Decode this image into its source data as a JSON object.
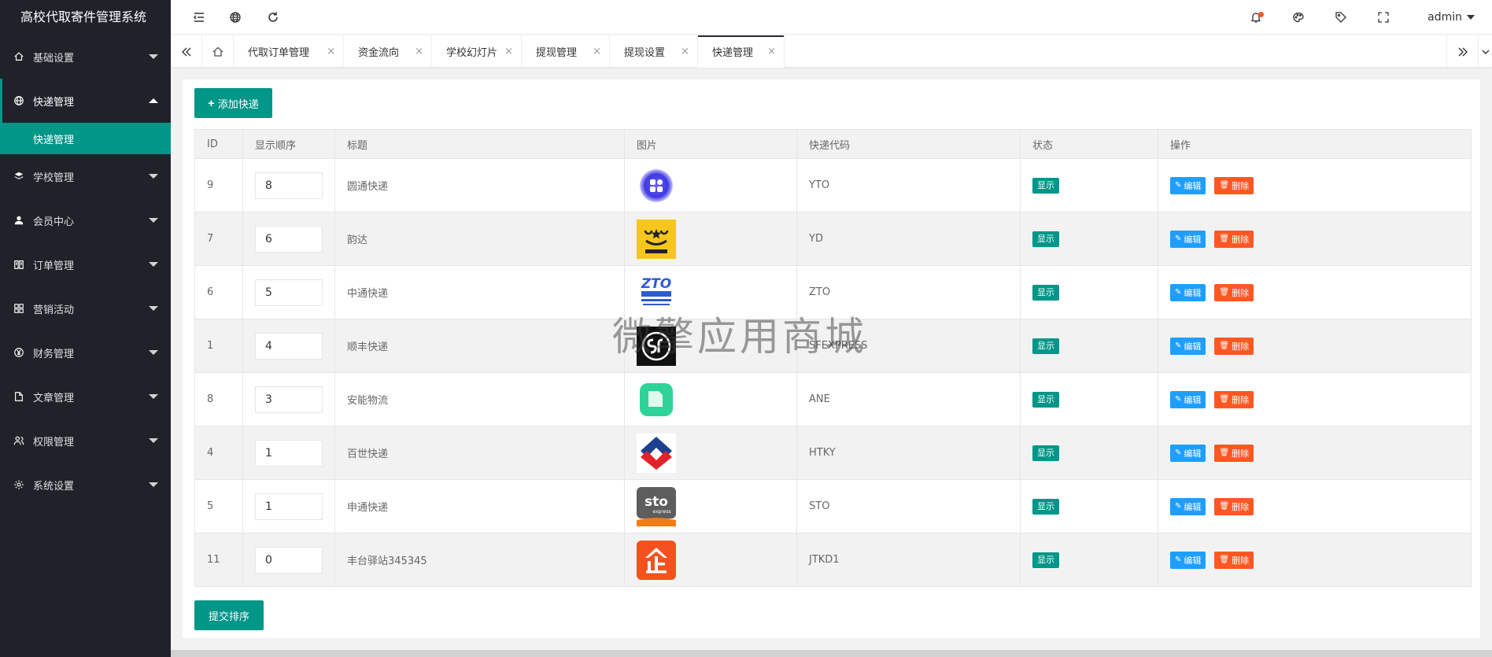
{
  "app": {
    "title": "高校代取寄件管理系统"
  },
  "sidebar": {
    "items": [
      {
        "label": "基础设置",
        "icon": "home-icon",
        "open": false
      },
      {
        "label": "快递管理",
        "icon": "globe-icon",
        "open": true,
        "sub": [
          {
            "label": "快递管理"
          }
        ]
      },
      {
        "label": "学校管理",
        "icon": "layers-icon",
        "open": false
      },
      {
        "label": "会员中心",
        "icon": "user-icon",
        "open": false
      },
      {
        "label": "订单管理",
        "icon": "book-icon",
        "open": false
      },
      {
        "label": "营销活动",
        "icon": "apps-icon",
        "open": false
      },
      {
        "label": "财务管理",
        "icon": "yen-icon",
        "open": false
      },
      {
        "label": "文章管理",
        "icon": "file-icon",
        "open": false
      },
      {
        "label": "权限管理",
        "icon": "group-user-icon",
        "open": false
      },
      {
        "label": "系统设置",
        "icon": "gear-icon",
        "open": false
      }
    ]
  },
  "header": {
    "user": "admin",
    "icons": [
      "menu-fold-icon",
      "globe-icon",
      "refresh-icon",
      "bell-icon",
      "theme-icon",
      "tag-icon",
      "fullscreen-icon"
    ]
  },
  "tabs": {
    "items": [
      {
        "label": "代取订单管理",
        "active": false
      },
      {
        "label": "资金流向",
        "active": false
      },
      {
        "label": "学校幻灯片",
        "active": false
      },
      {
        "label": "提现管理",
        "active": false
      },
      {
        "label": "提现设置",
        "active": false
      },
      {
        "label": "快递管理",
        "active": true
      }
    ],
    "close_glyph": "×"
  },
  "main": {
    "add_button": "添加快递",
    "submit_button": "提交排序",
    "columns": [
      "ID",
      "显示顺序",
      "标题",
      "图片",
      "快递代码",
      "状态",
      "操作"
    ],
    "status_label": "显示",
    "edit_label": "编辑",
    "delete_label": "删除",
    "rows": [
      {
        "id": "9",
        "order": "8",
        "title": "圆通快递",
        "logo": "yto-logo",
        "code": "YTO"
      },
      {
        "id": "7",
        "order": "6",
        "title": "韵达",
        "logo": "yunda-logo",
        "code": "YD"
      },
      {
        "id": "6",
        "order": "5",
        "title": "中通快递",
        "logo": "zto-logo",
        "code": "ZTO"
      },
      {
        "id": "1",
        "order": "4",
        "title": "顺丰快递",
        "logo": "sf-logo",
        "code": "SFEXPRESS"
      },
      {
        "id": "8",
        "order": "3",
        "title": "安能物流",
        "logo": "ane-logo",
        "code": "ANE"
      },
      {
        "id": "4",
        "order": "1",
        "title": "百世快递",
        "logo": "htky-logo",
        "code": "HTKY"
      },
      {
        "id": "5",
        "order": "1",
        "title": "申通快递",
        "logo": "sto-logo",
        "code": "STO"
      },
      {
        "id": "11",
        "order": "0",
        "title": "丰台驿站345345",
        "logo": "jtkd-logo",
        "code": "JTKD1"
      }
    ]
  },
  "watermark": "微擎应用商城",
  "colors": {
    "primary": "#009688",
    "sidebar": "#20222a",
    "edit": "#1e9fff",
    "danger": "#ff5722"
  }
}
